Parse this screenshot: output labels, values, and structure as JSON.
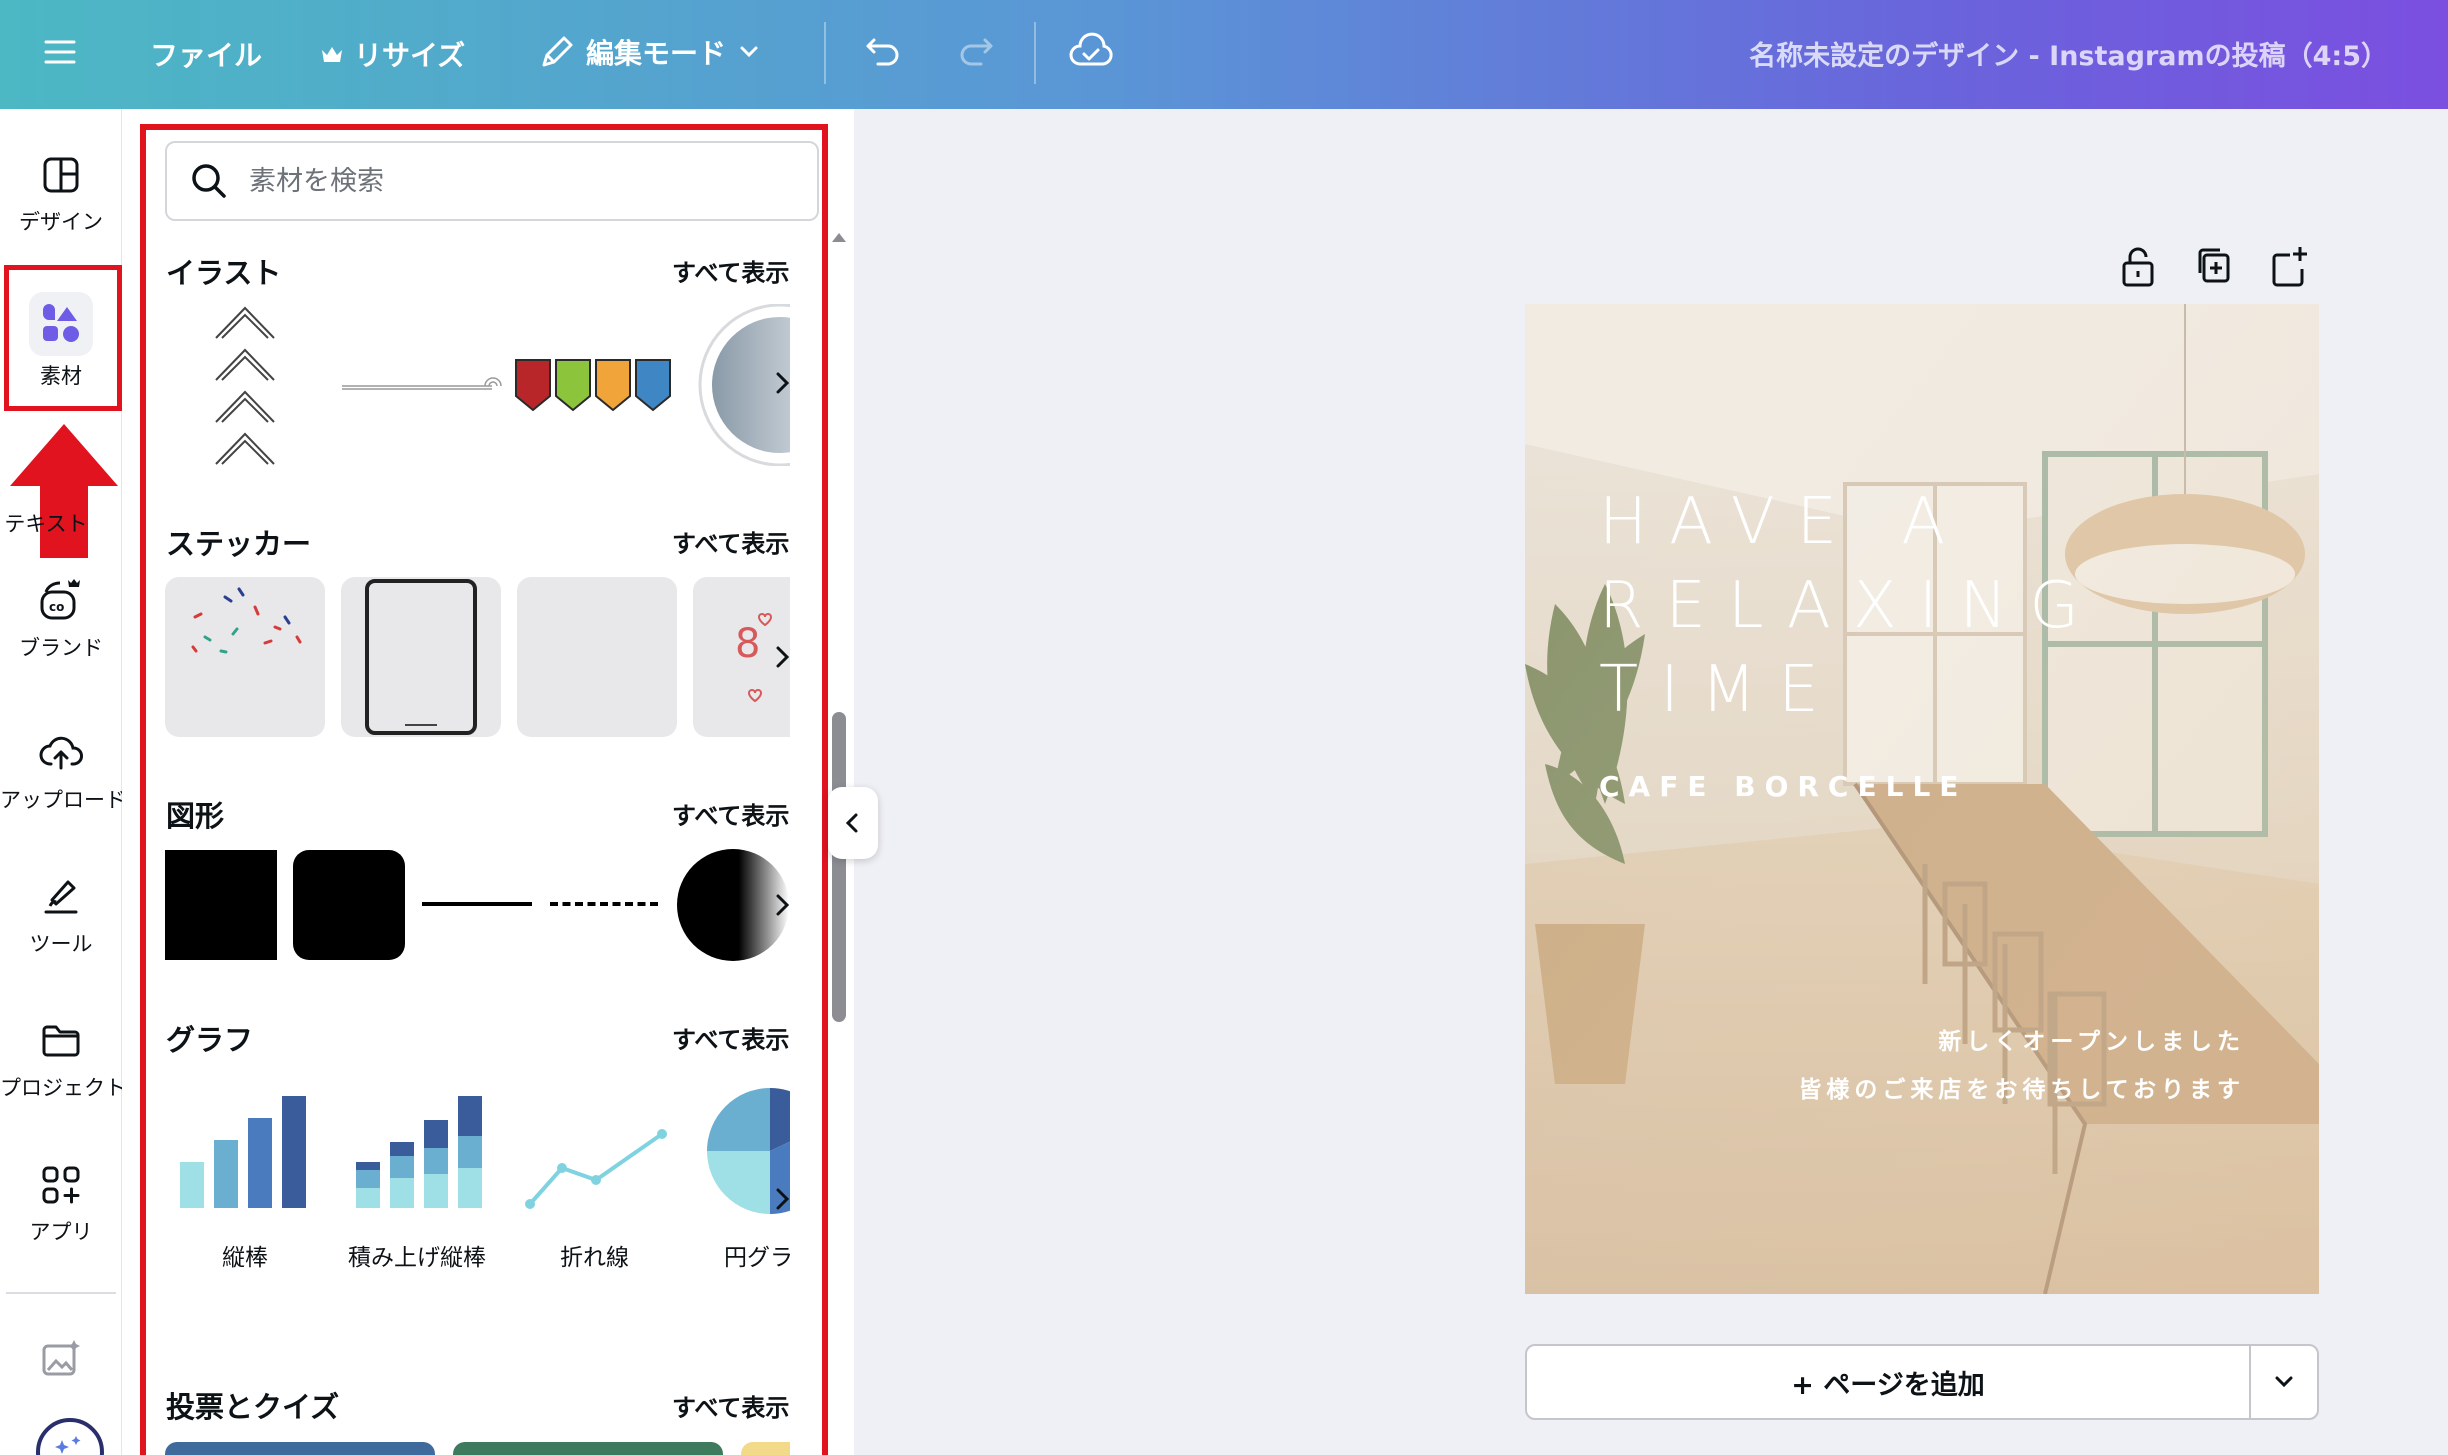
{
  "topbar": {
    "file": "ファイル",
    "resize": "リサイズ",
    "edit_mode": "編集モード",
    "doc_title": "名称未設定のデザイン - Instagramの投稿（4:5）"
  },
  "rail": {
    "items": [
      {
        "label": "デザイン"
      },
      {
        "label": "素材"
      },
      {
        "label": "テキスト"
      },
      {
        "label": "ブランド"
      },
      {
        "label": "アップロード"
      },
      {
        "label": "ツール"
      },
      {
        "label": "プロジェクト"
      },
      {
        "label": "アプリ"
      }
    ]
  },
  "panel": {
    "search_placeholder": "素材を検索",
    "see_all": "すべて表示",
    "sections": {
      "illust": "イラスト",
      "sticker": "ステッカー",
      "shapes": "図形",
      "graph": "グラフ",
      "poll": "投票とクイズ"
    },
    "graph_labels": [
      "縦棒",
      "積み上げ縦棒",
      "折れ線",
      "円グラ"
    ]
  },
  "design": {
    "headline": [
      "HAVE A",
      "RELAXING",
      "TIME"
    ],
    "subhead": "CAFE BORCELLE",
    "message": [
      "新しくオープンしました",
      "皆様のご来店をお待ちしております"
    ]
  },
  "canvas": {
    "add_page": "+ ページを追加"
  },
  "colors": {
    "highlight_red": "#e0131f",
    "accent_purple": "#7b4fe0"
  }
}
